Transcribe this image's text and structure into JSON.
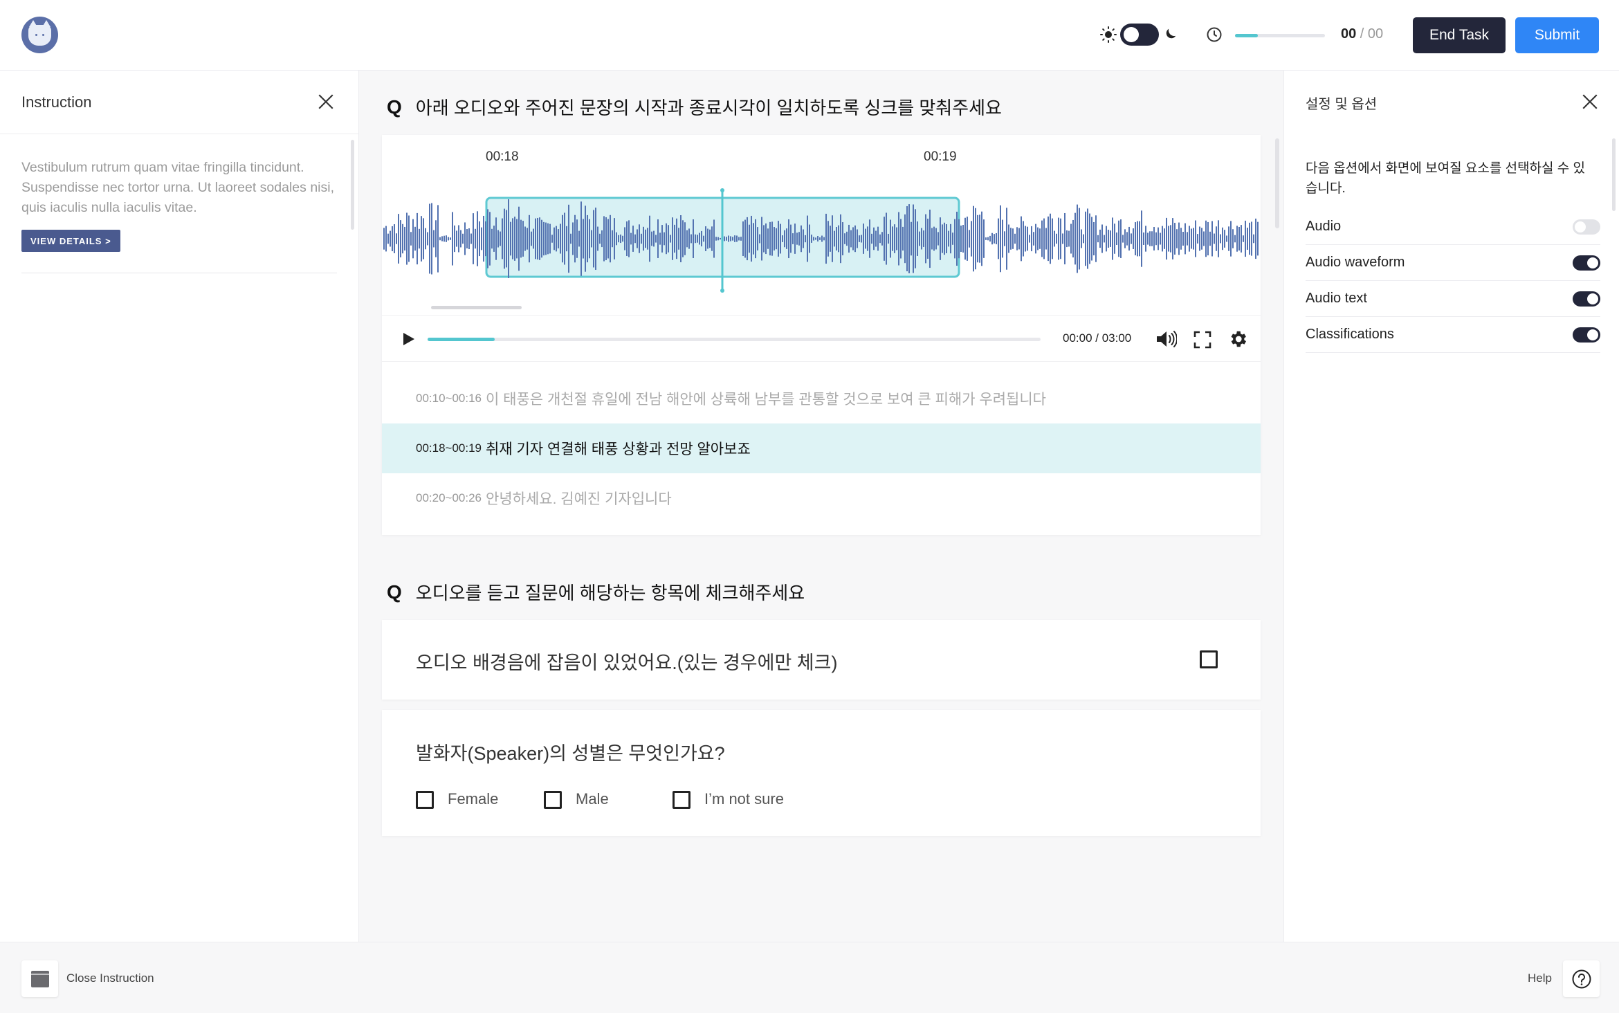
{
  "header": {
    "counter_current": "00",
    "counter_sep": " / ",
    "counter_total": "00",
    "progress_fraction": 0.25,
    "end_task_label": "End Task",
    "submit_label": "Submit",
    "icons": [
      "app-logo",
      "sun-icon",
      "moon-icon",
      "clock-icon"
    ],
    "colors": {
      "dark": "#23263a",
      "submit": "#2f86f6",
      "accent": "#54c6cf"
    }
  },
  "instruction": {
    "title": "Instruction",
    "body": "Vestibulum rutrum quam vitae fringilla tincidunt. Suspendisse nec tortor urna. Ut laoreet sodales nisi, quis iaculis nulla iaculis vitae.",
    "view_details_label": "VIEW DETAILS  >"
  },
  "settings": {
    "title": "설정 및 옵션",
    "description": "다음 옵션에서 화면에 보여질 요소를 선택하실 수 있습니다.",
    "options": [
      {
        "label": "Audio",
        "enabled": false
      },
      {
        "label": "Audio waveform",
        "enabled": true
      },
      {
        "label": "Audio text",
        "enabled": true
      },
      {
        "label": "Classifications",
        "enabled": true
      }
    ]
  },
  "question1": {
    "q_marker": "Q",
    "title": "아래 오디오와 주어진 문장의 시작과 종료시각이 일치하도록 싱크를 맞춰주세요",
    "timeline_ticks": [
      "00:18",
      "00:19"
    ],
    "player": {
      "time": "00:00 / 03:00",
      "progress_fraction": 0.11
    },
    "segments": [
      {
        "time": "00:10~00:16",
        "text": "이 태풍은 개천절 휴일에 전남 해안에 상륙해 남부를 관통할 것으로 보여 큰 피해가 우려됩니다",
        "active": false
      },
      {
        "time": "00:18~00:19",
        "text": "취재 기자 연결해 태풍 상황과 전망 알아보죠",
        "active": true
      },
      {
        "time": "00:20~00:26",
        "text": "안녕하세요. 김예진 기자입니다",
        "active": false
      }
    ]
  },
  "question2": {
    "q_marker": "Q",
    "title": "오디오를 듣고 질문에 해당하는 항목에 체크해주세요",
    "noise_question": "오디오 배경음에 잡음이 있었어요.(있는 경우에만 체크)",
    "gender_question": "발화자(Speaker)의 성별은 무엇인가요?",
    "gender_options": [
      "Female",
      "Male",
      "I’m not sure"
    ]
  },
  "footer": {
    "close_instruction_label": "Close Instruction",
    "help_label": "Help"
  }
}
